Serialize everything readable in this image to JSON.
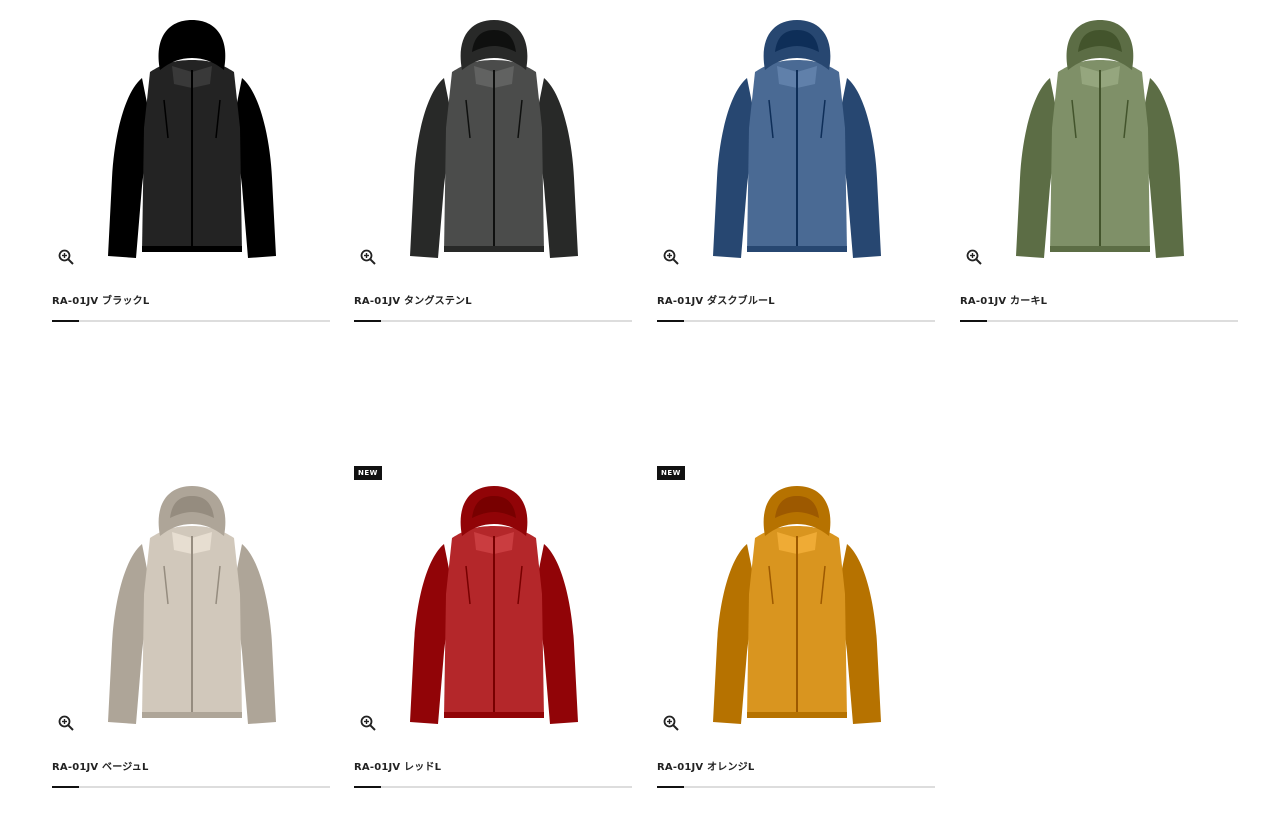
{
  "products": [
    {
      "name": "RA-01JV ブラックL",
      "color": "#232323",
      "badge": "",
      "zoom_icon": "zoom-in-icon"
    },
    {
      "name": "RA-01JV タングステンL",
      "color": "#4b4c4b",
      "badge": "",
      "zoom_icon": "zoom-in-icon"
    },
    {
      "name": "RA-01JV ダスクブルーL",
      "color": "#4a6a94",
      "badge": "",
      "zoom_icon": "zoom-in-icon"
    },
    {
      "name": "RA-01JV カーキL",
      "color": "#7f9068",
      "badge": "",
      "zoom_icon": "zoom-in-icon"
    },
    {
      "name": "RA-01JV ベージュL",
      "color": "#d1c8bb",
      "badge": "",
      "zoom_icon": "zoom-in-icon"
    },
    {
      "name": "RA-01JV レッドL",
      "color": "#b4272a",
      "badge": "NEW",
      "zoom_icon": "zoom-in-icon"
    },
    {
      "name": "RA-01JV オレンジL",
      "color": "#d9951f",
      "badge": "NEW",
      "zoom_icon": "zoom-in-icon"
    }
  ]
}
